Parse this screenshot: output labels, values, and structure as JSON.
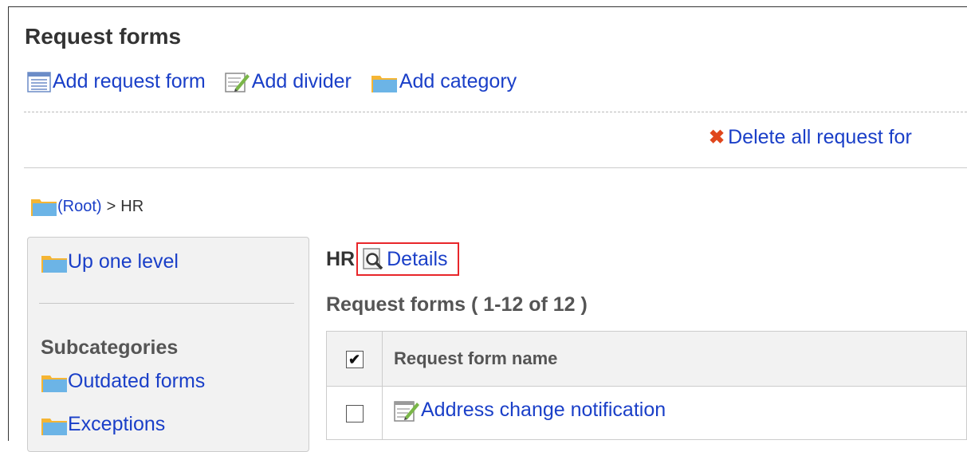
{
  "page": {
    "title": "Request forms"
  },
  "toolbar": {
    "add_form": "Add request form",
    "add_divider": "Add divider",
    "add_category": "Add category",
    "delete_all": "Delete all request for"
  },
  "breadcrumb": {
    "root": "(Root)",
    "separator": ">",
    "current": "HR"
  },
  "sidebar": {
    "up_one_level": "Up one level",
    "subcategories_heading": "Subcategories",
    "subcategories": [
      "Outdated forms",
      "Exceptions"
    ]
  },
  "main": {
    "category_name": "HR",
    "details_label": "Details",
    "count_label": "Request forms ( 1-12 of 12 )"
  },
  "table": {
    "header_check": "✔",
    "header_name": "Request form name",
    "rows": [
      {
        "name": "Address change notification"
      }
    ]
  },
  "colors": {
    "link": "#1a3fc8",
    "highlight": "#e8262a",
    "delete": "#e0461c"
  }
}
